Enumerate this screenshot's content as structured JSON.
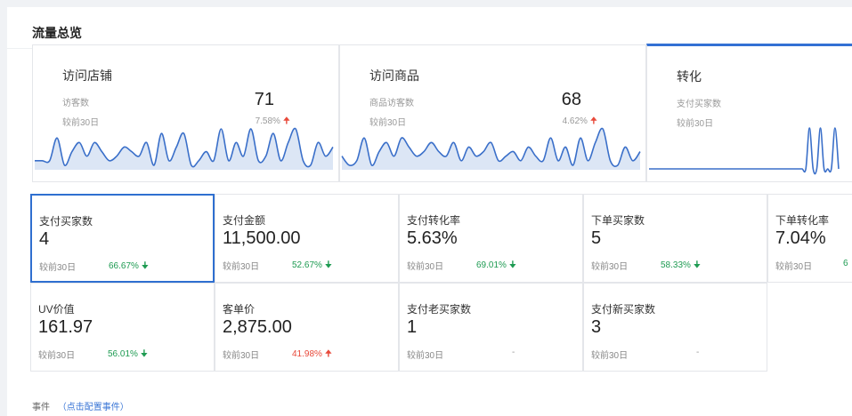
{
  "panel": {
    "title": "流量总览"
  },
  "trend_cards": [
    {
      "title": "访问店铺",
      "sub_label": "访客数",
      "compare_label": "较前30日",
      "value": "71",
      "change": "7.58%",
      "direction": "up",
      "active": false,
      "chart_data": {
        "type": "area",
        "values": [
          2,
          2,
          2,
          7,
          1,
          4,
          6,
          3,
          6,
          4,
          2,
          3,
          5,
          4,
          3,
          6,
          1,
          8,
          2,
          5,
          8,
          1,
          2,
          4,
          2,
          9,
          2,
          6,
          3,
          9,
          2,
          3,
          8,
          2,
          6,
          9,
          2,
          1,
          6,
          3,
          5
        ]
      }
    },
    {
      "title": "访问商品",
      "sub_label": "商品访客数",
      "compare_label": "较前30日",
      "value": "68",
      "change": "4.62%",
      "direction": "up",
      "active": false,
      "chart_data": {
        "type": "area",
        "values": [
          3,
          1,
          2,
          7,
          1,
          4,
          6,
          3,
          7,
          5,
          3,
          4,
          6,
          4,
          3,
          6,
          2,
          5,
          3,
          4,
          6,
          2,
          3,
          4,
          2,
          5,
          3,
          2,
          7,
          2,
          5,
          1,
          7,
          2,
          6,
          9,
          2,
          1,
          5,
          2,
          4
        ]
      }
    },
    {
      "title": "转化",
      "sub_label": "支付买家数",
      "compare_label": "较前30日",
      "value": "",
      "change": "",
      "direction": "",
      "active": true,
      "chart_data": {
        "type": "line",
        "values": [
          0,
          0,
          0,
          0,
          0,
          0,
          0,
          0,
          0,
          0,
          0,
          0,
          0,
          0,
          0,
          0,
          0,
          0,
          0,
          0,
          0,
          0,
          0,
          0,
          0,
          0,
          0,
          0,
          0,
          0,
          0,
          0,
          0,
          0,
          0,
          0,
          0,
          0,
          0,
          0,
          0,
          0,
          0,
          0,
          1,
          0,
          0,
          1,
          0,
          0,
          0,
          1,
          0
        ]
      }
    }
  ],
  "metrics": [
    {
      "label": "支付买家数",
      "value": "4",
      "compare_label": "较前30日",
      "change": "66.67%",
      "direction": "down",
      "selected": true
    },
    {
      "label": "支付金额",
      "value": "11,500.00",
      "compare_label": "较前30日",
      "change": "52.67%",
      "direction": "down",
      "selected": false
    },
    {
      "label": "支付转化率",
      "value": "5.63%",
      "compare_label": "较前30日",
      "change": "69.01%",
      "direction": "down",
      "selected": false
    },
    {
      "label": "下单买家数",
      "value": "5",
      "compare_label": "较前30日",
      "change": "58.33%",
      "direction": "down",
      "selected": false
    },
    {
      "label": "下单转化率",
      "value": "7.04%",
      "compare_label": "较前30日",
      "change": "6",
      "direction": "none",
      "selected": false
    },
    {
      "label": "UV价值",
      "value": "161.97",
      "compare_label": "较前30日",
      "change": "56.01%",
      "direction": "down",
      "selected": false
    },
    {
      "label": "客单价",
      "value": "2,875.00",
      "compare_label": "较前30日",
      "change": "41.98%",
      "direction": "up",
      "selected": false
    },
    {
      "label": "支付老买家数",
      "value": "1",
      "compare_label": "较前30日",
      "change": "-",
      "direction": "none",
      "selected": false
    },
    {
      "label": "支付新买家数",
      "value": "3",
      "compare_label": "较前30日",
      "change": "-",
      "direction": "none",
      "selected": false
    }
  ],
  "events": {
    "label": "事件",
    "link": "（点击配置事件）"
  },
  "colors": {
    "accent": "#3370d4",
    "line": "#3a6fc9",
    "fill": "#dce6f5",
    "up": "#e8493a",
    "down": "#1e9b52"
  },
  "icons": {
    "up": "arrow-up-icon",
    "down": "arrow-down-icon"
  }
}
